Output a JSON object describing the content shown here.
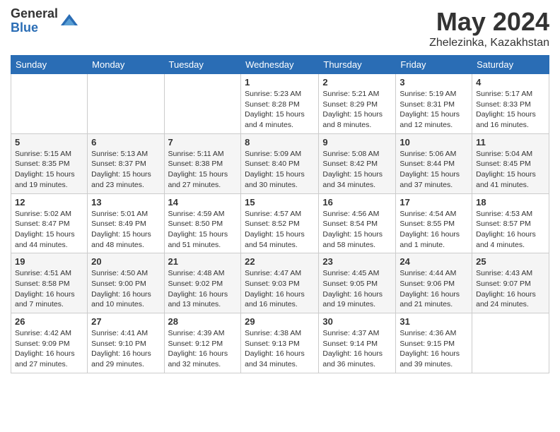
{
  "logo": {
    "general": "General",
    "blue": "Blue"
  },
  "title": "May 2024",
  "subtitle": "Zhelezinka, Kazakhstan",
  "days_of_week": [
    "Sunday",
    "Monday",
    "Tuesday",
    "Wednesday",
    "Thursday",
    "Friday",
    "Saturday"
  ],
  "weeks": [
    [
      {
        "day": "",
        "sunrise": "",
        "sunset": "",
        "daylight": ""
      },
      {
        "day": "",
        "sunrise": "",
        "sunset": "",
        "daylight": ""
      },
      {
        "day": "",
        "sunrise": "",
        "sunset": "",
        "daylight": ""
      },
      {
        "day": "1",
        "sunrise": "Sunrise: 5:23 AM",
        "sunset": "Sunset: 8:28 PM",
        "daylight": "Daylight: 15 hours and 4 minutes."
      },
      {
        "day": "2",
        "sunrise": "Sunrise: 5:21 AM",
        "sunset": "Sunset: 8:29 PM",
        "daylight": "Daylight: 15 hours and 8 minutes."
      },
      {
        "day": "3",
        "sunrise": "Sunrise: 5:19 AM",
        "sunset": "Sunset: 8:31 PM",
        "daylight": "Daylight: 15 hours and 12 minutes."
      },
      {
        "day": "4",
        "sunrise": "Sunrise: 5:17 AM",
        "sunset": "Sunset: 8:33 PM",
        "daylight": "Daylight: 15 hours and 16 minutes."
      }
    ],
    [
      {
        "day": "5",
        "sunrise": "Sunrise: 5:15 AM",
        "sunset": "Sunset: 8:35 PM",
        "daylight": "Daylight: 15 hours and 19 minutes."
      },
      {
        "day": "6",
        "sunrise": "Sunrise: 5:13 AM",
        "sunset": "Sunset: 8:37 PM",
        "daylight": "Daylight: 15 hours and 23 minutes."
      },
      {
        "day": "7",
        "sunrise": "Sunrise: 5:11 AM",
        "sunset": "Sunset: 8:38 PM",
        "daylight": "Daylight: 15 hours and 27 minutes."
      },
      {
        "day": "8",
        "sunrise": "Sunrise: 5:09 AM",
        "sunset": "Sunset: 8:40 PM",
        "daylight": "Daylight: 15 hours and 30 minutes."
      },
      {
        "day": "9",
        "sunrise": "Sunrise: 5:08 AM",
        "sunset": "Sunset: 8:42 PM",
        "daylight": "Daylight: 15 hours and 34 minutes."
      },
      {
        "day": "10",
        "sunrise": "Sunrise: 5:06 AM",
        "sunset": "Sunset: 8:44 PM",
        "daylight": "Daylight: 15 hours and 37 minutes."
      },
      {
        "day": "11",
        "sunrise": "Sunrise: 5:04 AM",
        "sunset": "Sunset: 8:45 PM",
        "daylight": "Daylight: 15 hours and 41 minutes."
      }
    ],
    [
      {
        "day": "12",
        "sunrise": "Sunrise: 5:02 AM",
        "sunset": "Sunset: 8:47 PM",
        "daylight": "Daylight: 15 hours and 44 minutes."
      },
      {
        "day": "13",
        "sunrise": "Sunrise: 5:01 AM",
        "sunset": "Sunset: 8:49 PM",
        "daylight": "Daylight: 15 hours and 48 minutes."
      },
      {
        "day": "14",
        "sunrise": "Sunrise: 4:59 AM",
        "sunset": "Sunset: 8:50 PM",
        "daylight": "Daylight: 15 hours and 51 minutes."
      },
      {
        "day": "15",
        "sunrise": "Sunrise: 4:57 AM",
        "sunset": "Sunset: 8:52 PM",
        "daylight": "Daylight: 15 hours and 54 minutes."
      },
      {
        "day": "16",
        "sunrise": "Sunrise: 4:56 AM",
        "sunset": "Sunset: 8:54 PM",
        "daylight": "Daylight: 15 hours and 58 minutes."
      },
      {
        "day": "17",
        "sunrise": "Sunrise: 4:54 AM",
        "sunset": "Sunset: 8:55 PM",
        "daylight": "Daylight: 16 hours and 1 minute."
      },
      {
        "day": "18",
        "sunrise": "Sunrise: 4:53 AM",
        "sunset": "Sunset: 8:57 PM",
        "daylight": "Daylight: 16 hours and 4 minutes."
      }
    ],
    [
      {
        "day": "19",
        "sunrise": "Sunrise: 4:51 AM",
        "sunset": "Sunset: 8:58 PM",
        "daylight": "Daylight: 16 hours and 7 minutes."
      },
      {
        "day": "20",
        "sunrise": "Sunrise: 4:50 AM",
        "sunset": "Sunset: 9:00 PM",
        "daylight": "Daylight: 16 hours and 10 minutes."
      },
      {
        "day": "21",
        "sunrise": "Sunrise: 4:48 AM",
        "sunset": "Sunset: 9:02 PM",
        "daylight": "Daylight: 16 hours and 13 minutes."
      },
      {
        "day": "22",
        "sunrise": "Sunrise: 4:47 AM",
        "sunset": "Sunset: 9:03 PM",
        "daylight": "Daylight: 16 hours and 16 minutes."
      },
      {
        "day": "23",
        "sunrise": "Sunrise: 4:45 AM",
        "sunset": "Sunset: 9:05 PM",
        "daylight": "Daylight: 16 hours and 19 minutes."
      },
      {
        "day": "24",
        "sunrise": "Sunrise: 4:44 AM",
        "sunset": "Sunset: 9:06 PM",
        "daylight": "Daylight: 16 hours and 21 minutes."
      },
      {
        "day": "25",
        "sunrise": "Sunrise: 4:43 AM",
        "sunset": "Sunset: 9:07 PM",
        "daylight": "Daylight: 16 hours and 24 minutes."
      }
    ],
    [
      {
        "day": "26",
        "sunrise": "Sunrise: 4:42 AM",
        "sunset": "Sunset: 9:09 PM",
        "daylight": "Daylight: 16 hours and 27 minutes."
      },
      {
        "day": "27",
        "sunrise": "Sunrise: 4:41 AM",
        "sunset": "Sunset: 9:10 PM",
        "daylight": "Daylight: 16 hours and 29 minutes."
      },
      {
        "day": "28",
        "sunrise": "Sunrise: 4:39 AM",
        "sunset": "Sunset: 9:12 PM",
        "daylight": "Daylight: 16 hours and 32 minutes."
      },
      {
        "day": "29",
        "sunrise": "Sunrise: 4:38 AM",
        "sunset": "Sunset: 9:13 PM",
        "daylight": "Daylight: 16 hours and 34 minutes."
      },
      {
        "day": "30",
        "sunrise": "Sunrise: 4:37 AM",
        "sunset": "Sunset: 9:14 PM",
        "daylight": "Daylight: 16 hours and 36 minutes."
      },
      {
        "day": "31",
        "sunrise": "Sunrise: 4:36 AM",
        "sunset": "Sunset: 9:15 PM",
        "daylight": "Daylight: 16 hours and 39 minutes."
      },
      {
        "day": "",
        "sunrise": "",
        "sunset": "",
        "daylight": ""
      }
    ]
  ]
}
